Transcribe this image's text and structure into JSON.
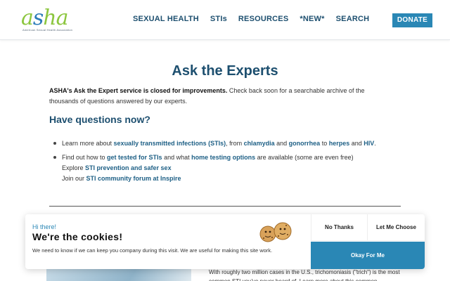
{
  "header": {
    "logo_text": "asha",
    "logo_subtitle": "American Sexual Health Association",
    "nav": [
      "SEXUAL HEALTH",
      "STIs",
      "RESOURCES",
      "*NEW*",
      "SEARCH"
    ],
    "donate_label": "DONATE"
  },
  "main": {
    "title": "Ask the Experts",
    "intro_bold": "ASHA's Ask the Expert service is closed for improvements.",
    "intro_rest": " Check back soon for a searchable archive of the thousands of questions answered by our experts.",
    "section_heading": "Have questions now?",
    "bullet1": {
      "t1": "Learn more about ",
      "l1": "sexually transmitted infections (STIs)",
      "t2": ", from ",
      "l2": "chlamydia",
      "t3": " and ",
      "l3": "gonorrhea",
      "t4": " to ",
      "l4": "herpes",
      "t5": " and ",
      "l5": "HIV",
      "t6": "."
    },
    "bullet2": {
      "t1": "Find out how to ",
      "l1": "get tested for STIs",
      "t2": " and what ",
      "l2": "home testing options",
      "t3": " are available (some are even free)",
      "t4": "Explore ",
      "l3": "STI prevention and safer sex",
      "t5": "Join our ",
      "l4": "STI community forum at Inspire"
    },
    "article_text": "With roughly two million cases in the U.S., trichomoniasis (\"trich\") is the most common STI you've never heard of. Learn more about this common"
  },
  "cookie": {
    "greeting": "Hi there!",
    "title": "We're the cookies!",
    "text": "We need to know if we can keep you company during this visit. We are useful for making this site work.",
    "no_label": "No Thanks",
    "choose_label": "Let Me Choose",
    "ok_label": "Okay For Me"
  },
  "colors": {
    "brand_navy": "#1d4f6f",
    "accent_blue": "#2a87b5",
    "logo_green": "#8cc63f"
  }
}
